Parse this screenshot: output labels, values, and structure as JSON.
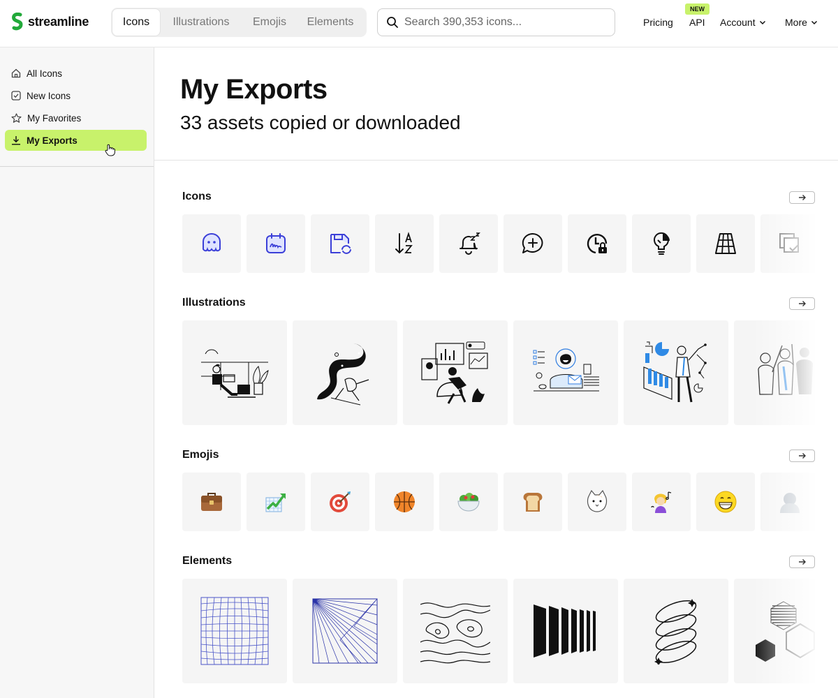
{
  "brand": {
    "name": "streamline",
    "accent": "#22a93a",
    "highlight": "#c8f26b"
  },
  "tabs": [
    {
      "label": "Icons",
      "active": true
    },
    {
      "label": "Illustrations",
      "active": false
    },
    {
      "label": "Emojis",
      "active": false
    },
    {
      "label": "Elements",
      "active": false
    }
  ],
  "search": {
    "placeholder": "Search 390,353 icons..."
  },
  "nav": {
    "pricing": "Pricing",
    "api": "API",
    "api_badge": "NEW",
    "account": "Account",
    "more": "More"
  },
  "sidebar": {
    "items": [
      {
        "label": "All Icons",
        "icon": "home-icon"
      },
      {
        "label": "New Icons",
        "icon": "checkbox-icon"
      },
      {
        "label": "My Favorites",
        "icon": "star-icon"
      },
      {
        "label": "My Exports",
        "icon": "download-icon",
        "active": true
      }
    ]
  },
  "page": {
    "title": "My Exports",
    "subtitle": "33 assets copied or downloaded"
  },
  "sections": {
    "icons": {
      "title": "Icons",
      "items": [
        "ghost-icon",
        "calendar-signature-icon",
        "floppy-sync-icon",
        "sort-az-icon",
        "bell-snooze-icon",
        "chat-add-icon",
        "clock-lock-icon",
        "lightbulb-pie-icon",
        "grid-perspective-icon",
        "copy-check-icon"
      ]
    },
    "illustrations": {
      "title": "Illustrations",
      "items": [
        "person-laptop-illustration",
        "space-swirl-illustration",
        "dashboard-relax-illustration",
        "support-desk-illustration",
        "analytics-presenter-illustration",
        "team-highfive-illustration"
      ]
    },
    "emojis": {
      "title": "Emojis",
      "items": [
        "briefcase-emoji",
        "chart-up-emoji",
        "target-emoji",
        "basketball-emoji",
        "salad-emoji",
        "bread-emoji",
        "cat-emoji",
        "singer-emoji",
        "grinning-face-emoji",
        "bust-emoji"
      ]
    },
    "elements": {
      "title": "Elements",
      "items": [
        "warped-grid-element",
        "line-fan-element",
        "topographic-element",
        "black-bars-element",
        "spiral-rings-element",
        "hexagon-element"
      ]
    }
  }
}
